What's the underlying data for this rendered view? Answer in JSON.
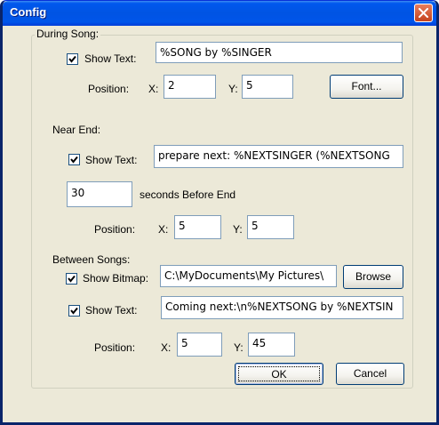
{
  "window": {
    "title": "Config"
  },
  "during_song": {
    "legend": "During Song:",
    "show_text_label": "Show Text:",
    "show_text_value": "%SONG by %SINGER",
    "position_label": "Position:",
    "x_label": "X:",
    "x_value": "2",
    "y_label": "Y:",
    "y_value": "5",
    "font_button": "Font..."
  },
  "near_end": {
    "label": "Near End:",
    "show_text_label": "Show Text:",
    "show_text_value": "prepare next: %NEXTSINGER (%NEXTSONG",
    "seconds_value": "30",
    "seconds_label": "seconds  Before End",
    "position_label": "Position:",
    "x_label": "X:",
    "x_value": "5",
    "y_label": "Y:",
    "y_value": "5"
  },
  "between_songs": {
    "label": "Between Songs:",
    "show_bitmap_label": "Show Bitmap:",
    "bitmap_path": "C:\\MyDocuments\\My Pictures\\",
    "browse_button": "Browse",
    "show_text_label": "Show Text:",
    "show_text_value": "Coming next:\\n%NEXTSONG by %NEXTSIN",
    "position_label": "Position:",
    "x_label": "X:",
    "x_value": "5",
    "y_label": "Y:",
    "y_value": "45"
  },
  "buttons": {
    "ok": "OK",
    "cancel": "Cancel"
  },
  "colors": {
    "titlebar": "#0054e3",
    "face": "#ece9d8",
    "close": "#c4431d",
    "check": "#21a121"
  }
}
